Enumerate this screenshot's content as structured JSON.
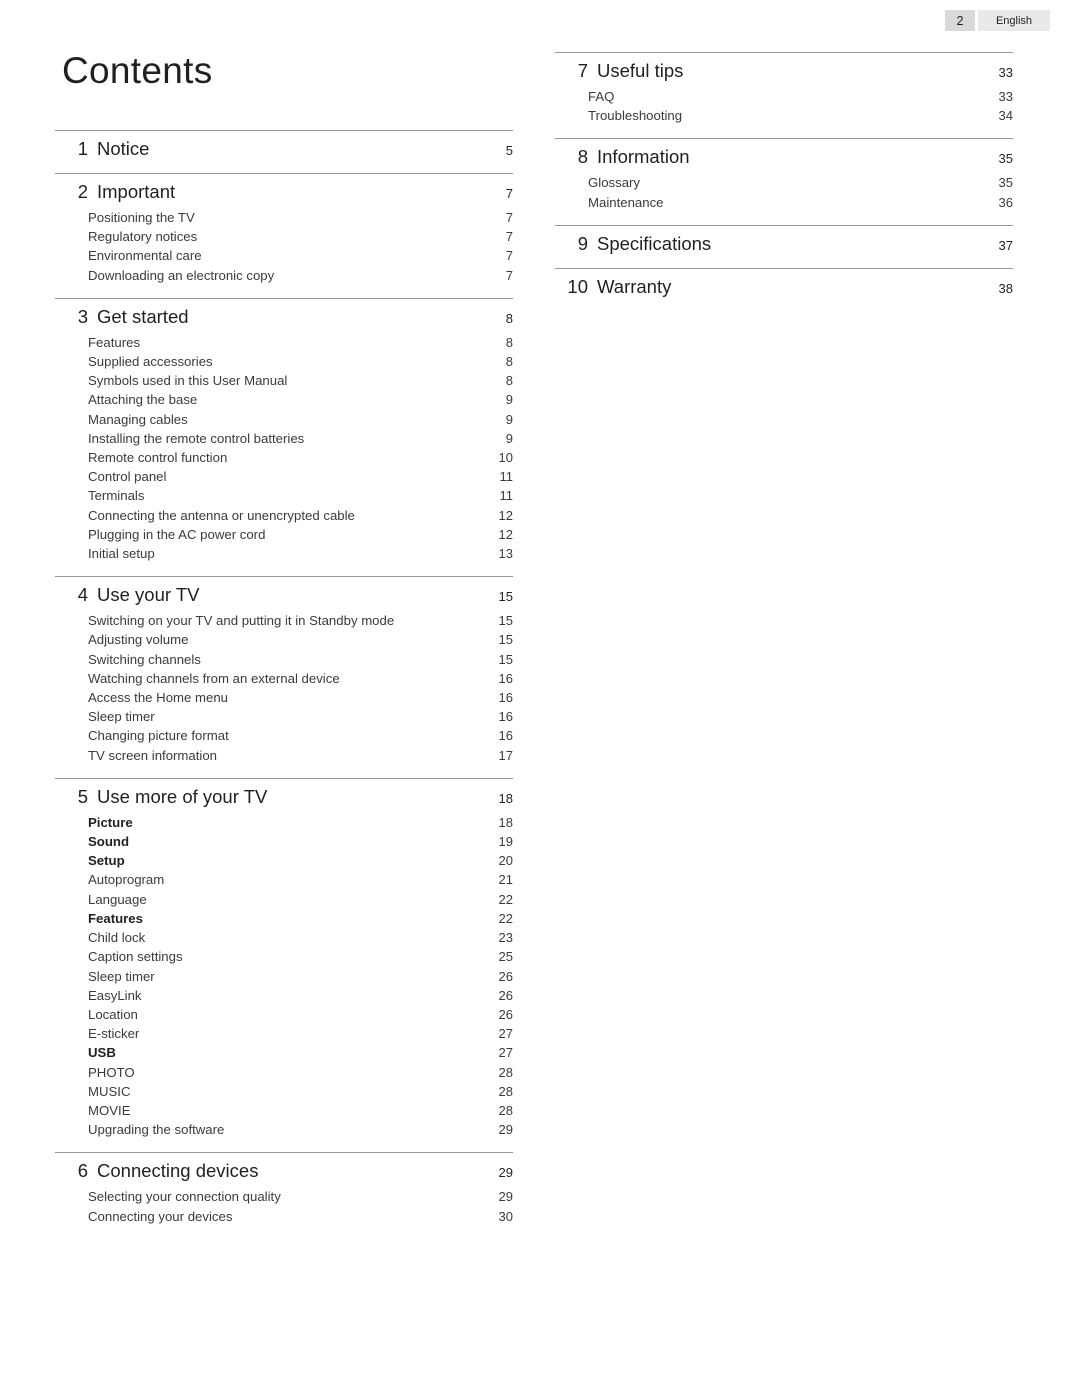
{
  "header": {
    "page_number": "2",
    "language": "English"
  },
  "title": "Contents",
  "left_column": [
    {
      "num": "1",
      "label": "Notice",
      "page": "5",
      "entries": []
    },
    {
      "num": "2",
      "label": "Important",
      "page": "7",
      "entries": [
        {
          "label": "Positioning the TV",
          "page": "7",
          "bold": false
        },
        {
          "label": "Regulatory notices",
          "page": "7",
          "bold": false
        },
        {
          "label": "Environmental care",
          "page": "7",
          "bold": false
        },
        {
          "label": "Downloading an electronic copy",
          "page": "7",
          "bold": false
        }
      ]
    },
    {
      "num": "3",
      "label": "Get started",
      "page": "8",
      "entries": [
        {
          "label": "Features",
          "page": "8",
          "bold": false
        },
        {
          "label": "Supplied accessories",
          "page": "8",
          "bold": false
        },
        {
          "label": "Symbols used in this User Manual",
          "page": "8",
          "bold": false
        },
        {
          "label": "Attaching the base",
          "page": "9",
          "bold": false
        },
        {
          "label": "Managing cables",
          "page": "9",
          "bold": false
        },
        {
          "label": "Installing the remote control batteries",
          "page": "9",
          "bold": false
        },
        {
          "label": "Remote control function",
          "page": "10",
          "bold": false
        },
        {
          "label": "Control panel",
          "page": "11",
          "bold": false
        },
        {
          "label": "Terminals",
          "page": "11",
          "bold": false
        },
        {
          "label": "Connecting the antenna or unencrypted cable",
          "page": "12",
          "bold": false
        },
        {
          "label": "Plugging in the AC power cord",
          "page": "12",
          "bold": false
        },
        {
          "label": "Initial setup",
          "page": "13",
          "bold": false
        }
      ]
    },
    {
      "num": "4",
      "label": "Use your TV",
      "page": "15",
      "entries": [
        {
          "label": "Switching on your TV and putting it in Standby mode",
          "page": "15",
          "bold": false
        },
        {
          "label": "Adjusting volume",
          "page": "15",
          "bold": false
        },
        {
          "label": "Switching channels",
          "page": "15",
          "bold": false
        },
        {
          "label": "Watching channels from an external device",
          "page": "16",
          "bold": false
        },
        {
          "label": "Access the Home menu",
          "page": "16",
          "bold": false
        },
        {
          "label": "Sleep timer",
          "page": "16",
          "bold": false
        },
        {
          "label": "Changing picture format",
          "page": "16",
          "bold": false
        },
        {
          "label": "TV screen information",
          "page": "17",
          "bold": false
        }
      ]
    },
    {
      "num": "5",
      "label": "Use more of your TV",
      "page": "18",
      "entries": [
        {
          "label": "Picture",
          "page": "18",
          "bold": true
        },
        {
          "label": "Sound",
          "page": "19",
          "bold": true
        },
        {
          "label": "Setup",
          "page": "20",
          "bold": true
        },
        {
          "label": "Autoprogram",
          "page": "21",
          "bold": false
        },
        {
          "label": "Language",
          "page": "22",
          "bold": false
        },
        {
          "label": "Features",
          "page": "22",
          "bold": true
        },
        {
          "label": "Child lock",
          "page": "23",
          "bold": false
        },
        {
          "label": "Caption settings",
          "page": "25",
          "bold": false
        },
        {
          "label": "Sleep timer",
          "page": "26",
          "bold": false
        },
        {
          "label": "EasyLink",
          "page": "26",
          "bold": false
        },
        {
          "label": "Location",
          "page": "26",
          "bold": false
        },
        {
          "label": "E-sticker",
          "page": "27",
          "bold": false
        },
        {
          "label": "USB",
          "page": "27",
          "bold": true
        },
        {
          "label": "PHOTO",
          "page": "28",
          "bold": false
        },
        {
          "label": "MUSIC",
          "page": "28",
          "bold": false
        },
        {
          "label": "MOVIE",
          "page": "28",
          "bold": false
        },
        {
          "label": "Upgrading the software",
          "page": "29",
          "bold": false
        }
      ]
    },
    {
      "num": "6",
      "label": "Connecting devices",
      "page": "29",
      "entries": [
        {
          "label": "Selecting your connection quality",
          "page": "29",
          "bold": false
        },
        {
          "label": "Connecting your devices",
          "page": "30",
          "bold": false
        }
      ]
    }
  ],
  "right_column": [
    {
      "num": "7",
      "label": "Useful tips",
      "page": "33",
      "entries": [
        {
          "label": "FAQ",
          "page": "33",
          "bold": false
        },
        {
          "label": "Troubleshooting",
          "page": "34",
          "bold": false
        }
      ]
    },
    {
      "num": "8",
      "label": "Information",
      "page": "35",
      "entries": [
        {
          "label": "Glossary",
          "page": "35",
          "bold": false
        },
        {
          "label": "Maintenance",
          "page": "36",
          "bold": false
        }
      ]
    },
    {
      "num": "9",
      "label": "Specifications",
      "page": "37",
      "entries": []
    },
    {
      "num": "10",
      "label": "Warranty",
      "page": "38",
      "entries": []
    }
  ]
}
